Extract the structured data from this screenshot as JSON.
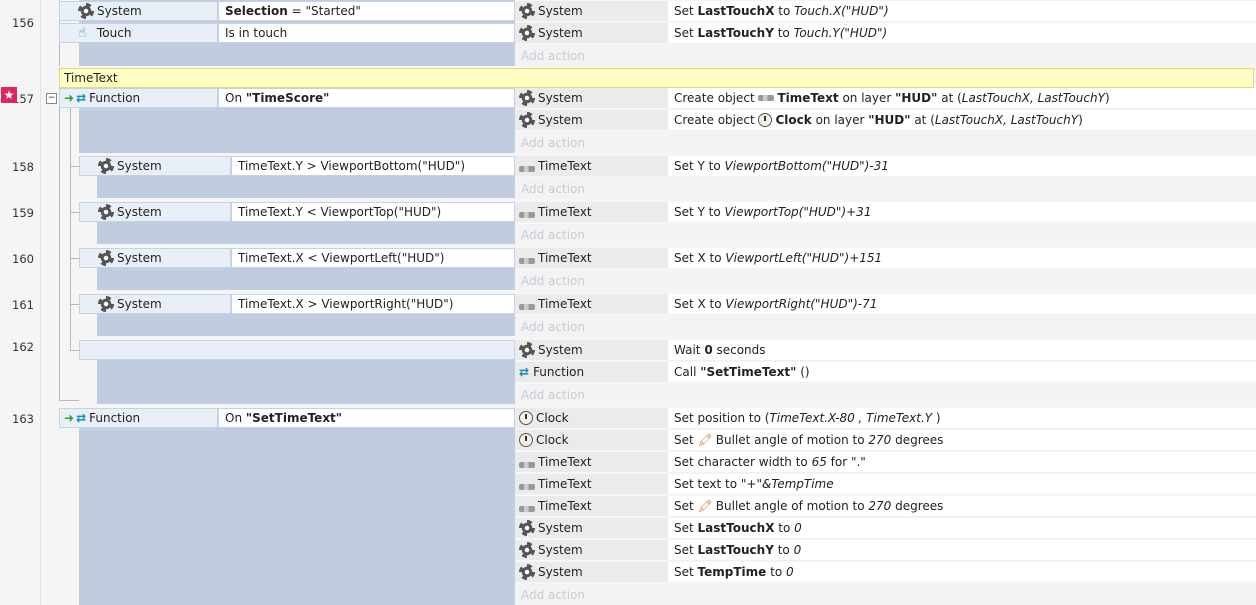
{
  "comment": {
    "text": "TimeText"
  },
  "add_action_label": "Add action",
  "line_numbers": [
    "156",
    "157",
    "158",
    "159",
    "160",
    "161",
    "162",
    "163"
  ],
  "events": {
    "e156": {
      "conditions": [
        {
          "object": "System",
          "icon": "gear-icon",
          "text_bold": "Selection",
          "text_rest": " = \"Started\""
        },
        {
          "object": "Touch",
          "icon": "touch-icon",
          "text": "Is in touch"
        }
      ],
      "actions": [
        {
          "object": "System",
          "pre": "Set ",
          "bold": "LastTouchX",
          "mid": " to ",
          "ital": "Touch.X(\"HUD\")"
        },
        {
          "object": "System",
          "pre": "Set ",
          "bold": "LastTouchY",
          "mid": " to ",
          "ital": "Touch.Y(\"HUD\")"
        }
      ]
    },
    "e157": {
      "condition": {
        "object": "Function",
        "pre": "On ",
        "bold": "\"TimeScore\""
      },
      "actions": [
        {
          "object": "System",
          "pre": "Create object ",
          "obj": "TimeText",
          "mid": " on layer ",
          "layer": "\"HUD\"",
          "at": " at (",
          "ital": "LastTouchX, LastTouchY",
          "end": ")"
        },
        {
          "object": "System",
          "pre": "Create object ",
          "obj": "Clock",
          "mid": " on layer ",
          "layer": "\"HUD\"",
          "at": " at (",
          "ital": "LastTouchX, LastTouchY",
          "end": ")"
        }
      ]
    },
    "e158": {
      "cond_object": "System",
      "cond_text": "TimeText.Y > ViewportBottom(\"HUD\")",
      "act_object": "TimeText",
      "act_pre": "Set Y to ",
      "act_ital": "ViewportBottom(\"HUD\")-31"
    },
    "e159": {
      "cond_object": "System",
      "cond_text": "TimeText.Y < ViewportTop(\"HUD\")",
      "act_object": "TimeText",
      "act_pre": "Set Y to ",
      "act_ital": "ViewportTop(\"HUD\")+31"
    },
    "e160": {
      "cond_object": "System",
      "cond_text": "TimeText.X < ViewportLeft(\"HUD\")",
      "act_object": "TimeText",
      "act_pre": "Set X to ",
      "act_ital": "ViewportLeft(\"HUD\")+151"
    },
    "e161": {
      "cond_object": "System",
      "cond_text": "TimeText.X > ViewportRight(\"HUD\")",
      "act_object": "TimeText",
      "act_pre": "Set X to ",
      "act_ital": "ViewportRight(\"HUD\")-71"
    },
    "e162": {
      "actions": [
        {
          "object": "System",
          "pre": "Wait ",
          "bold": "0",
          "post": " seconds"
        },
        {
          "object": "Function",
          "pre": "Call ",
          "bold": "\"SetTimeText\"",
          "post": " ()"
        }
      ]
    },
    "e163": {
      "condition": {
        "object": "Function",
        "pre": "On ",
        "bold": "\"SetTimeText\""
      },
      "actions": [
        {
          "object": "Clock",
          "pre": "Set position to (",
          "ital": "TimeText.X-80 , TimeText.Y ",
          "post": ")"
        },
        {
          "object": "Clock",
          "pre": "Set ",
          "behavior": "Bullet angle of motion to ",
          "ital": "270",
          "post": " degrees"
        },
        {
          "object": "TimeText",
          "pre": "Set character width to ",
          "ital": "65",
          "post": " for \".\""
        },
        {
          "object": "TimeText",
          "pre": "Set text to ",
          "ital": "\"+\"&TempTime"
        },
        {
          "object": "TimeText",
          "pre": "Set ",
          "behavior": "Bullet angle of motion to ",
          "ital": "270",
          "post": " degrees"
        },
        {
          "object": "System",
          "pre": "Set ",
          "bold": "LastTouchX",
          "mid": " to ",
          "ital": "0"
        },
        {
          "object": "System",
          "pre": "Set ",
          "bold": "LastTouchY",
          "mid": " to ",
          "ital": "0"
        },
        {
          "object": "System",
          "pre": "Set ",
          "bold": "TempTime",
          "mid": " to ",
          "ital": "0"
        }
      ]
    }
  }
}
